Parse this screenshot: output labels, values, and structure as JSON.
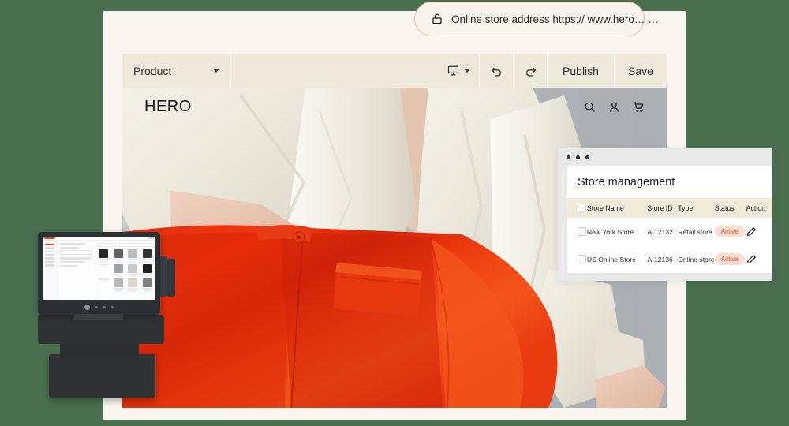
{
  "theme": {
    "background_green": "#4a7050",
    "card_cream": "#faf6ef",
    "toolbar_beige": "#efe9db",
    "accent_orange": "#e8461f",
    "badge_bg": "#fbe0d2",
    "pill_border": "#f3bda0",
    "table_header_bg": "#f0ead9"
  },
  "address_bar": {
    "icon": "lock-icon",
    "text": "Online store address https:// www.hero… …"
  },
  "toolbar": {
    "page_selector_label": "Product",
    "page_selector_caret": "chevron-down-icon",
    "device_icon": "desktop-monitor-icon",
    "device_caret": "chevron-down-icon",
    "undo_icon": "undo-arrow-icon",
    "redo_icon": "redo-arrow-icon",
    "publish_label": "Publish",
    "save_label": "Save"
  },
  "storefront": {
    "logo": "HERO",
    "icons": [
      "search-icon",
      "account-person-icon",
      "shopping-cart-icon"
    ]
  },
  "store_panel": {
    "window_dots": 3,
    "title": "Store management",
    "columns": [
      "",
      "Store Name",
      "Store ID",
      "Type",
      "Status",
      "Action"
    ],
    "rows": [
      {
        "selected": false,
        "store_name": "New York Store",
        "store_id": "A-12132",
        "type": "Retail store",
        "status": "Active",
        "action_icon": "edit-pencil-icon"
      },
      {
        "selected": false,
        "store_name": "US Online Store",
        "store_id": "A-12136",
        "type": "Online store",
        "status": "Active",
        "action_icon": "edit-pencil-icon"
      }
    ]
  },
  "pos_terminal": {
    "device": "point-of-sale-terminal",
    "screen": "pos-product-grid-screen"
  }
}
